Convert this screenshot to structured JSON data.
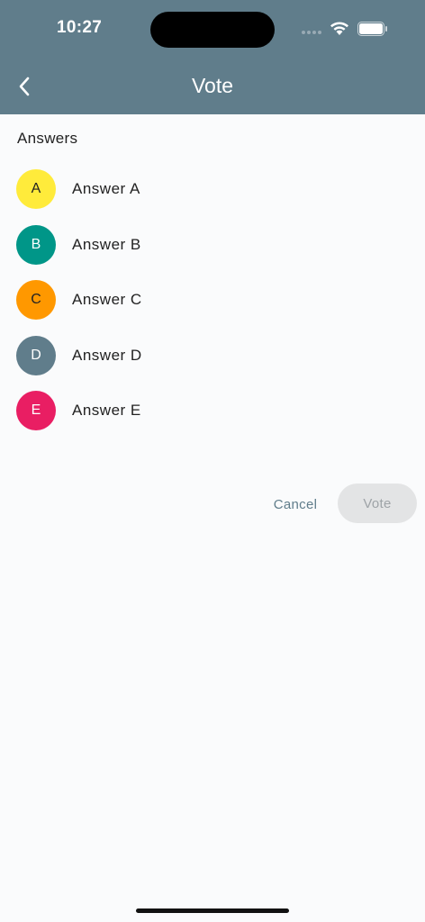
{
  "status_bar": {
    "time": "10:27"
  },
  "header": {
    "title": "Vote"
  },
  "section": {
    "label": "Answers"
  },
  "answers": [
    {
      "letter": "A",
      "label": "Answer A",
      "color": "#ffeb3b",
      "text_color": "#222222"
    },
    {
      "letter": "B",
      "label": "Answer B",
      "color": "#009688",
      "text_color": "#ffffff"
    },
    {
      "letter": "C",
      "label": "Answer C",
      "color": "#ff9800",
      "text_color": "#222222"
    },
    {
      "letter": "D",
      "label": "Answer D",
      "color": "#607d8b",
      "text_color": "#ffffff"
    },
    {
      "letter": "E",
      "label": "Answer E",
      "color": "#e91e63",
      "text_color": "#ffffff"
    }
  ],
  "actions": {
    "cancel_label": "Cancel",
    "vote_label": "Vote",
    "vote_enabled": false
  },
  "colors": {
    "header_bg": "#607d8b",
    "background": "#fafbfc"
  },
  "icons": {
    "back": "chevron-left-icon",
    "wifi": "wifi-icon",
    "battery": "battery-icon"
  }
}
